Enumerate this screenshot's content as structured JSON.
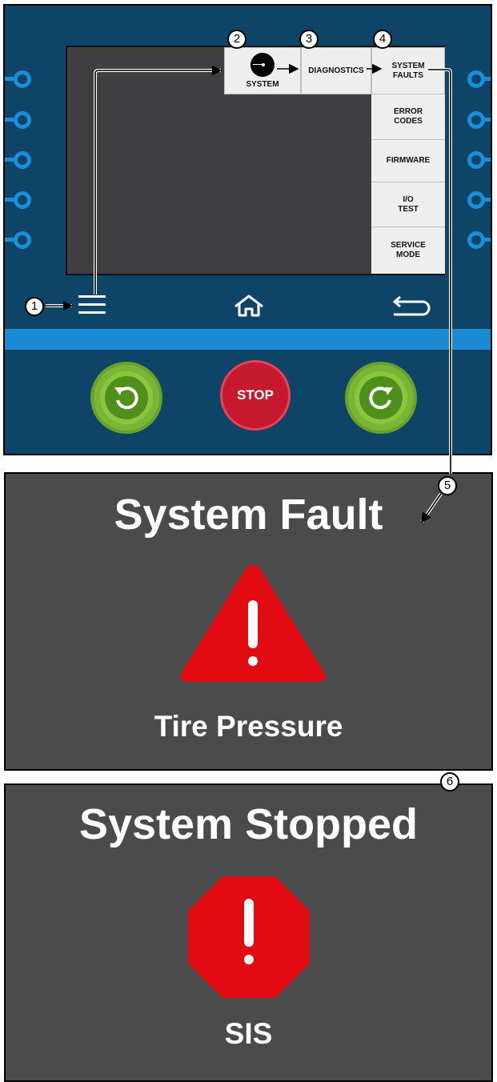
{
  "controller": {
    "tabs": {
      "system": "SYSTEM",
      "diagnostics": "DIAGNOSTICS",
      "system_faults": "SYSTEM\nFAULTS"
    },
    "menu_items": [
      "ERROR\nCODES",
      "FIRMWARE",
      "I/O\nTEST",
      "SERVICE\nMODE"
    ],
    "nav": {
      "menu_icon": "hamburger-menu-icon",
      "home_icon": "home-icon",
      "back_icon": "back-arrow-icon"
    },
    "buttons": {
      "stop_label": "STOP",
      "rotate_left_icon": "rotate-counterclockwise-icon",
      "rotate_right_icon": "rotate-clockwise-icon"
    }
  },
  "callouts": [
    "1",
    "2",
    "3",
    "4",
    "5",
    "6"
  ],
  "fault_panel": {
    "title": "System Fault",
    "message": "Tire Pressure",
    "icon": "warning-triangle-icon",
    "icon_color": "#e30b12"
  },
  "stopped_panel": {
    "title": "System Stopped",
    "message": "SIS",
    "icon": "stop-octagon-icon",
    "icon_color": "#e30b12"
  },
  "colors": {
    "panel_bg": "#0e4468",
    "accent_blue": "#1b8ad4",
    "alert_bg": "#4b4b4b",
    "green_button": "#8cc63f",
    "stop_red": "#c6192f"
  }
}
